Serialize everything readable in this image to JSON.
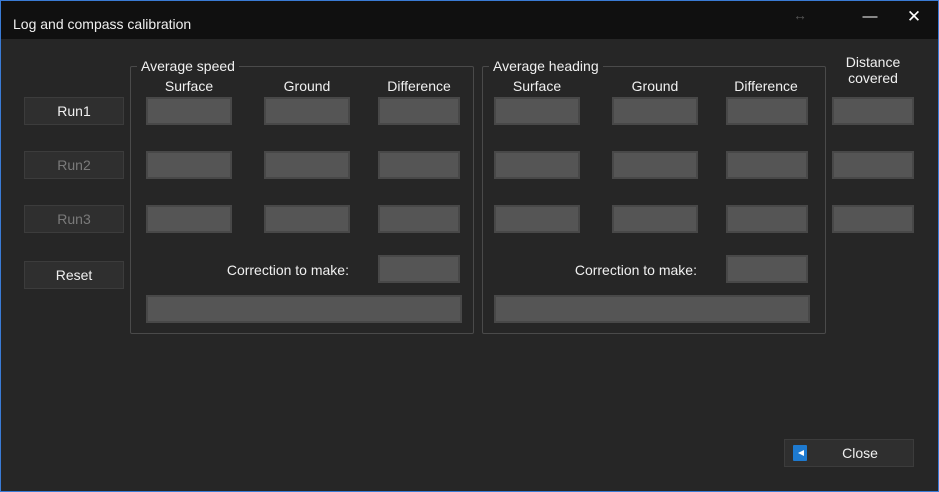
{
  "window": {
    "title": "Log and compass calibration",
    "resize_icon": "↔",
    "minimize_glyph": "—",
    "close_glyph": "✕"
  },
  "runs": {
    "run1": "Run1",
    "run2": "Run2",
    "run3": "Run3",
    "reset": "Reset"
  },
  "speed": {
    "title": "Average speed",
    "col_surface": "Surface",
    "col_ground": "Ground",
    "col_difference": "Difference",
    "correction_label": "Correction to make:"
  },
  "heading": {
    "title": "Average heading",
    "col_surface": "Surface",
    "col_ground": "Ground",
    "col_difference": "Difference",
    "correction_label": "Correction to make:"
  },
  "distance": {
    "header_line1": "Distance",
    "header_line2": "covered"
  },
  "footer": {
    "close_label": "Close"
  },
  "icons": {
    "close_button_icon": "exit-door-icon"
  },
  "colors": {
    "accent": "#1e7ad0",
    "window_border": "#3a7bd5",
    "field_fill": "#555555"
  }
}
